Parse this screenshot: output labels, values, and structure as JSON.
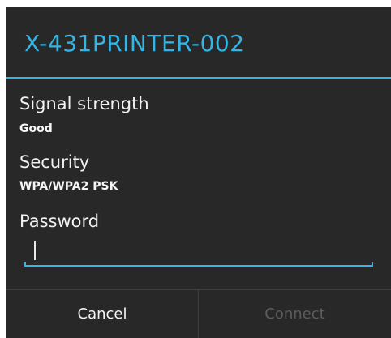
{
  "dialog": {
    "title": "X-431PRINTER-002",
    "signal": {
      "label": "Signal strength",
      "value": "Good"
    },
    "security": {
      "label": "Security",
      "value": "WPA/WPA2 PSK"
    },
    "password": {
      "label": "Password",
      "value": "",
      "placeholder": ""
    },
    "buttons": {
      "cancel": "Cancel",
      "connect": "Connect"
    }
  },
  "colors": {
    "accent": "#34b5e5",
    "background": "#282828",
    "text": "#f2f2f2",
    "disabled_text": "#5d5d5d"
  }
}
